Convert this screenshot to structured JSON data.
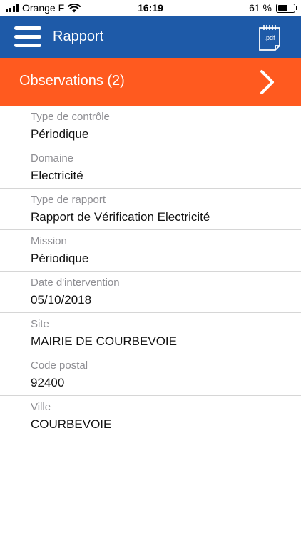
{
  "status_bar": {
    "carrier": "Orange F",
    "time": "16:19",
    "battery_percent": "61 %",
    "battery_level": 0.61
  },
  "header": {
    "title": "Rapport",
    "pdf_label": ".pdf",
    "color": "#1e5aa8"
  },
  "observations": {
    "label": "Observations (2)",
    "color": "#ff5a1f"
  },
  "fields": [
    {
      "label": "Type de contrôle",
      "value": "Périodique"
    },
    {
      "label": "Domaine",
      "value": "Electricité"
    },
    {
      "label": "Type de rapport",
      "value": "Rapport de Vérification Electricité"
    },
    {
      "label": "Mission",
      "value": "Périodique"
    },
    {
      "label": "Date d'intervention",
      "value": "05/10/2018"
    },
    {
      "label": "Site",
      "value": "MAIRIE DE COURBEVOIE"
    },
    {
      "label": "Code postal",
      "value": "92400"
    },
    {
      "label": "Ville",
      "value": "COURBEVOIE"
    }
  ]
}
